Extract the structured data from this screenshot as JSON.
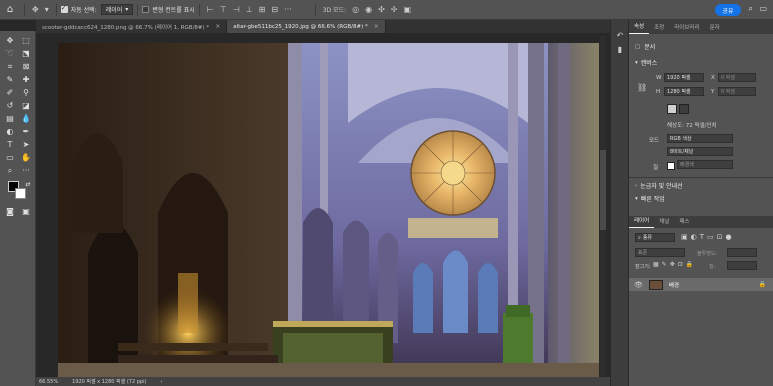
{
  "optbar": {
    "autoselect_label": "자동 선택:",
    "autoselect_value": "레이어",
    "transform_label": "변형 컨트롤 표시",
    "share_label": "공유"
  },
  "tabs": [
    {
      "label": "scooter-gddcacc624_1280.png @ 66.7% (레이어 1, RGB/8#) *"
    },
    {
      "label": "altar-gbe511bc25_1920.jpg @ 66.6% (RGB/8#) *"
    }
  ],
  "status": {
    "zoom": "66.55%",
    "doc_info": "1920 픽셀 x 1280 픽셀 (72 ppi)"
  },
  "properties": {
    "tabs": [
      "속성",
      "조정",
      "라이브러리",
      "문자"
    ],
    "doc_label": "문서",
    "canvas_label": "캔버스",
    "w_label": "W",
    "w_value": "1920 픽셀",
    "x_label": "X",
    "x_value": "0 픽셀",
    "h_label": "H",
    "h_value": "1280 픽셀",
    "y_label": "Y",
    "y_value": "0 픽셀",
    "resolution": "해상도: 72 픽셀/인치",
    "mode_label": "모드",
    "mode_value": "RGB 색상",
    "depth_value": "8비트/채널",
    "fill_label": "칠",
    "fill_value": "배경색",
    "guides_label": "눈금자 및 안내선",
    "more_label": "빠른 작업"
  },
  "layers": {
    "tabs": [
      "레이어",
      "채널",
      "패스"
    ],
    "filter_label": "종류",
    "blend_mode": "표준",
    "opacity_label": "불투명도:",
    "lock_label": "잠그기:",
    "fill_label": "칠:",
    "layer_name": "배경"
  },
  "colors": {
    "accent": "#1473e6",
    "panel": "#535353",
    "canvas_bg": "#282828"
  }
}
